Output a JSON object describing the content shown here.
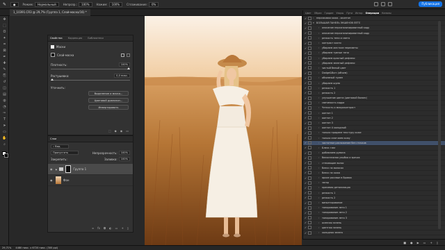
{
  "options_bar": {
    "mode_label": "Режим:",
    "mode_value": "Нормальный",
    "opacity_label": "Непрозр.:",
    "opacity_value": "100%",
    "flow_label": "Нажим:",
    "flow_value": "100%",
    "smoothing_label": "Сглаживание:",
    "smoothing_value": "0%",
    "publish_label": "Публикация"
  },
  "document_tab": "1_10391.CR3 @ 29,7% (Группа 1, Слой-маска/16) *",
  "tools": [
    "move-icon",
    "marquee-icon",
    "lasso-icon",
    "wand-icon",
    "crop-icon",
    "frame-icon",
    "eyedropper-icon",
    "healing-icon",
    "brush-icon",
    "stamp-icon",
    "history-brush-icon",
    "eraser-icon",
    "gradient-icon",
    "blur-icon",
    "dodge-icon",
    "pen-icon",
    "type-icon",
    "path-select-icon",
    "shape-icon",
    "hand-icon",
    "zoom-icon"
  ],
  "properties": {
    "tabs": [
      "Свойства",
      "Коррекция",
      "Библиотеки"
    ],
    "masks_label": "Маски",
    "layer_mask_label": "Слой-маска",
    "density_label": "Плотность:",
    "density_value": "100%",
    "feather_label": "Растушевка:",
    "feather_value": "0,0 пикс.",
    "refine_label": "Уточнить:",
    "select_mask_btn": "Выделение и маска...",
    "color_range_btn": "Цветовой диапазон...",
    "invert_btn": "Инвертировать"
  },
  "layers": {
    "tab": "Слои",
    "search_label": "Вид",
    "blend_mode": "Пропустить",
    "opacity_label": "Непрозрачность:",
    "opacity_value": "100%",
    "lock_label": "Закрепить:",
    "fill_label": "Заливка:",
    "fill_value": "100%",
    "rows": [
      {
        "name": "Группа 1"
      },
      {
        "name": "Фон"
      }
    ]
  },
  "right_panel": {
    "tabs": [
      "Цвет",
      "Образ",
      "Градие",
      "Узоры",
      "Пути",
      "Истор",
      "Операции",
      "Каналы"
    ],
    "active_tab": "Операции",
    "actions": [
      "персиковая кожа - оконтон",
      "БОЛЬШАЯ ПАНЕЛЬ ЭКШЕНОВ ЛЕТО",
      "описание персонализированный кадр",
      "описание персонализированный кадр",
      "резкость тени и света",
      "контраст кисти",
      "убираем жесткие пересветы",
      "убираем тувные тени",
      "убираем красный рефлекс",
      "убираем зеленый рефлекс",
      "чистый белый цвет",
      "Dodge&Burn (объем)",
      "объемный тумен",
      "убираем шума",
      "резкость 1",
      "резкость 2",
      "улучшение цвета (цветовой баланс)",
      "светимость кадра",
      "Четкость и микроконтраст",
      "оонтон 1",
      "оонтон 2",
      "оонтон 3",
      "оонтон 4 холодный",
      "только придаем текстуру коже",
      "только смягчаем кожу",
      "частотное разложение без стичков",
      "Блеск глаз",
      "добавляем румяна",
      "белоснежная улыбка и зрачок",
      "стекающие волос",
      "блеск на волосах",
      "блеск на кожа",
      "яркие рассвые в бровях",
      "загар",
      "красивая детализация",
      "резкость 1",
      "резкость 2",
      "виньетирование",
      "тонирование лето 1",
      "тонирование лето 2",
      "тонирование лето 3",
      "осенная зелень",
      "цветная зелень",
      "холодная зелень"
    ],
    "selected_index": 25
  },
  "status": {
    "zoom": "29,71%",
    "doc_info": "4480 пикс. x 6720 пикс. (300 ppi)"
  }
}
